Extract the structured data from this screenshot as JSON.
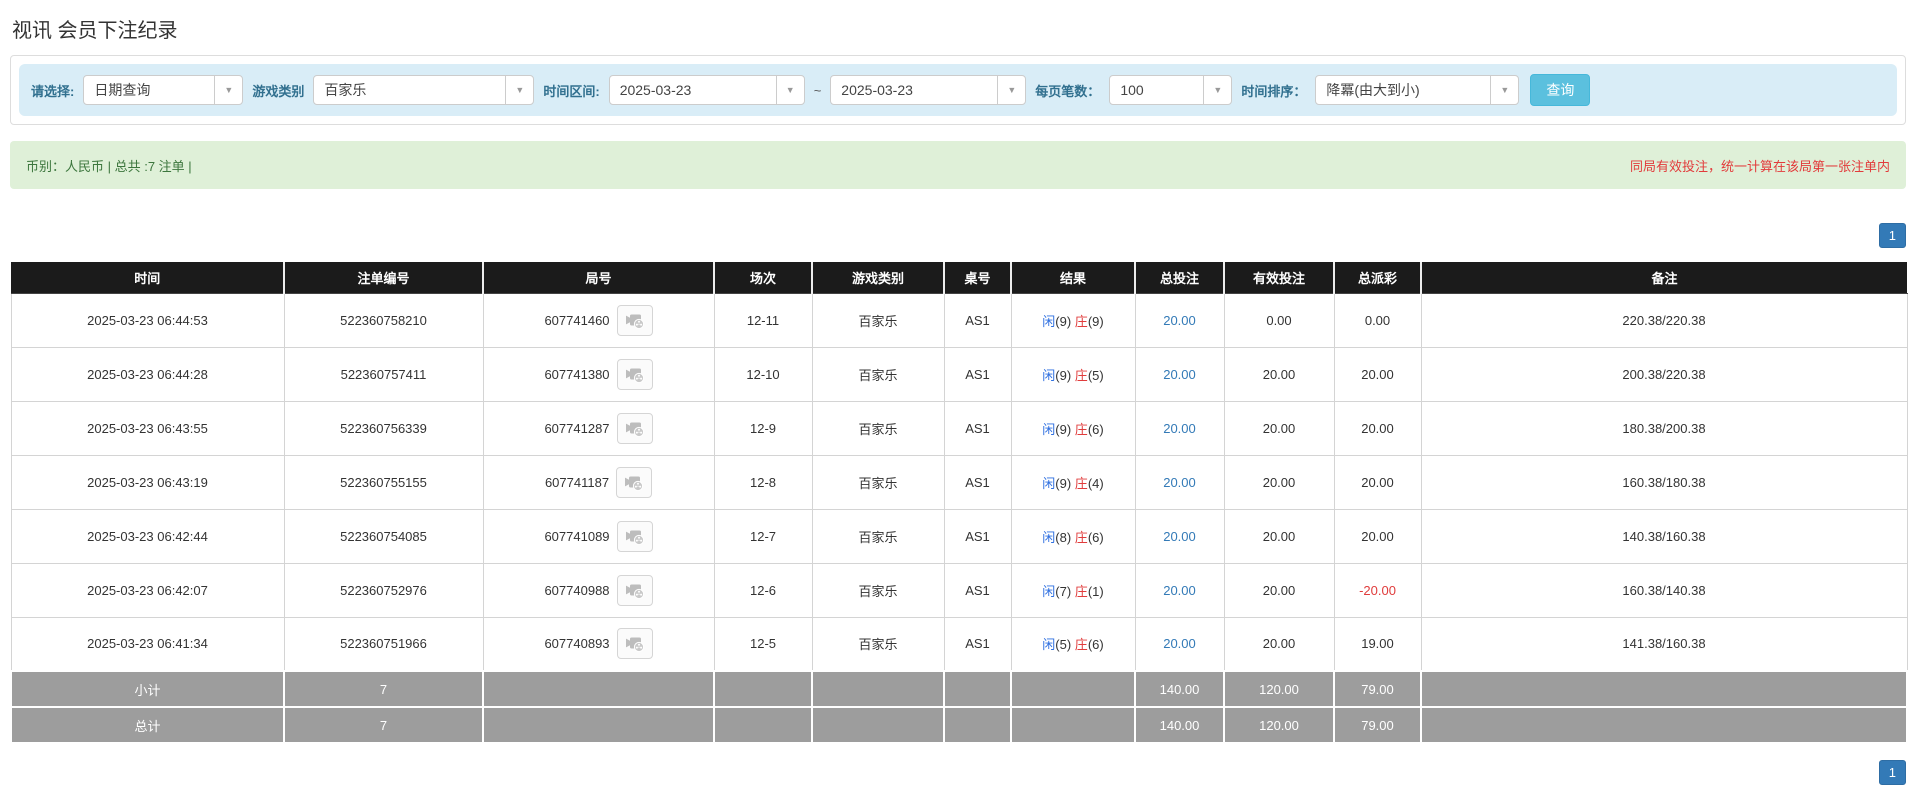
{
  "page": {
    "title": "视讯 会员下注纪录"
  },
  "colors": {
    "accent": "#5bc0de",
    "filter_bg": "#d9edf7",
    "label": "#31708f",
    "summary_bg": "#dff0d8",
    "summary_text": "#3c763d",
    "notice_text": "#e23b3b",
    "pager": "#337ab7",
    "header_bg": "#1b1b1b",
    "gray_row": "#9d9d9d",
    "player": "#2e6fe0",
    "banker": "#e03c3c",
    "link": "#337ab7",
    "negative": "#e03c3c"
  },
  "filters": {
    "select_label": "请选择:",
    "select_value": "日期查询",
    "game_label": "游戏类别",
    "game_value": "百家乐",
    "range_label": "时间区间:",
    "date_from": "2025-03-23",
    "tilde": "~",
    "date_to": "2025-03-23",
    "page_size_label": "每页笔数：",
    "page_size_value": "100",
    "sort_label": "时间排序：",
    "sort_value": "降冪(由大到小)",
    "search_button": "查询"
  },
  "summary": {
    "left": "币别：人民币 | 总共 :7 注单 |",
    "right": "同局有效投注，统一计算在该局第一张注单内"
  },
  "pagination": {
    "page": "1"
  },
  "table": {
    "headers": [
      "时间",
      "注单编号",
      "局号",
      "场次",
      "游戏类别",
      "桌号",
      "结果",
      "总投注",
      "有效投注",
      "总派彩",
      "备注"
    ],
    "rows": [
      {
        "time": "2025-03-23 06:44:53",
        "bet_id": "522360758210",
        "round_id": "607741460",
        "session": "12-11",
        "game": "百家乐",
        "table_no": "AS1",
        "result": {
          "p_label": "闲",
          "p_score": "(9)",
          "b_label": "庄",
          "b_score": "(9)"
        },
        "total_bet": "20.00",
        "valid_bet": "0.00",
        "payout": "0.00",
        "note": "220.38/220.38"
      },
      {
        "time": "2025-03-23 06:44:28",
        "bet_id": "522360757411",
        "round_id": "607741380",
        "session": "12-10",
        "game": "百家乐",
        "table_no": "AS1",
        "result": {
          "p_label": "闲",
          "p_score": "(9)",
          "b_label": "庄",
          "b_score": "(5)"
        },
        "total_bet": "20.00",
        "valid_bet": "20.00",
        "payout": "20.00",
        "note": "200.38/220.38"
      },
      {
        "time": "2025-03-23 06:43:55",
        "bet_id": "522360756339",
        "round_id": "607741287",
        "session": "12-9",
        "game": "百家乐",
        "table_no": "AS1",
        "result": {
          "p_label": "闲",
          "p_score": "(9)",
          "b_label": "庄",
          "b_score": "(6)"
        },
        "total_bet": "20.00",
        "valid_bet": "20.00",
        "payout": "20.00",
        "note": "180.38/200.38"
      },
      {
        "time": "2025-03-23 06:43:19",
        "bet_id": "522360755155",
        "round_id": "607741187",
        "session": "12-8",
        "game": "百家乐",
        "table_no": "AS1",
        "result": {
          "p_label": "闲",
          "p_score": "(9)",
          "b_label": "庄",
          "b_score": "(4)"
        },
        "total_bet": "20.00",
        "valid_bet": "20.00",
        "payout": "20.00",
        "note": "160.38/180.38"
      },
      {
        "time": "2025-03-23 06:42:44",
        "bet_id": "522360754085",
        "round_id": "607741089",
        "session": "12-7",
        "game": "百家乐",
        "table_no": "AS1",
        "result": {
          "p_label": "闲",
          "p_score": "(8)",
          "b_label": "庄",
          "b_score": "(6)"
        },
        "total_bet": "20.00",
        "valid_bet": "20.00",
        "payout": "20.00",
        "note": "140.38/160.38"
      },
      {
        "time": "2025-03-23 06:42:07",
        "bet_id": "522360752976",
        "round_id": "607740988",
        "session": "12-6",
        "game": "百家乐",
        "table_no": "AS1",
        "result": {
          "p_label": "闲",
          "p_score": "(7)",
          "b_label": "庄",
          "b_score": "(1)"
        },
        "total_bet": "20.00",
        "valid_bet": "20.00",
        "payout": "-20.00",
        "note": "160.38/140.38"
      },
      {
        "time": "2025-03-23 06:41:34",
        "bet_id": "522360751966",
        "round_id": "607740893",
        "session": "12-5",
        "game": "百家乐",
        "table_no": "AS1",
        "result": {
          "p_label": "闲",
          "p_score": "(5)",
          "b_label": "庄",
          "b_score": "(6)"
        },
        "total_bet": "20.00",
        "valid_bet": "20.00",
        "payout": "19.00",
        "note": "141.38/160.38"
      }
    ],
    "subtotal": {
      "label": "小计",
      "count": "7",
      "total_bet": "140.00",
      "valid_bet": "120.00",
      "payout": "79.00"
    },
    "total": {
      "label": "总计",
      "count": "7",
      "total_bet": "140.00",
      "valid_bet": "120.00",
      "payout": "79.00"
    }
  }
}
